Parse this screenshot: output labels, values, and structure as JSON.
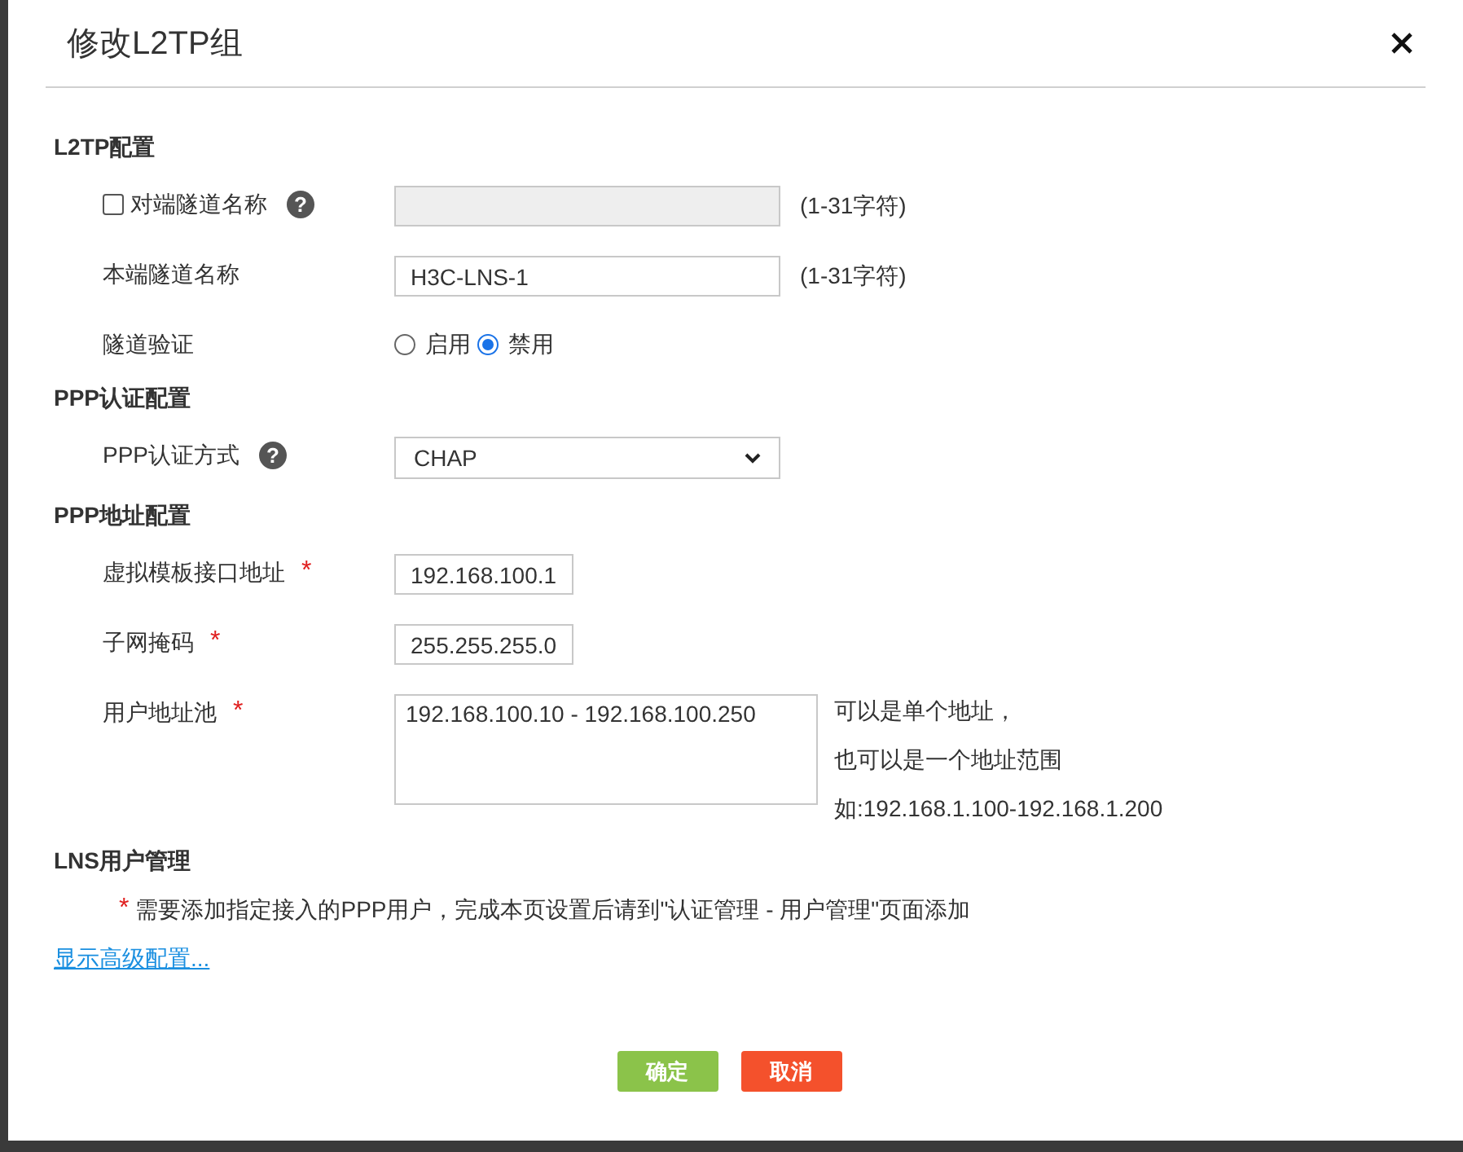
{
  "dialog": {
    "title": "修改L2TP组"
  },
  "sections": [
    {
      "heading": "L2TP配置",
      "rows": [
        {
          "kind": "input",
          "label": "对端隧道名称",
          "checkbox": {
            "checked": false
          },
          "help": "?",
          "disabled": true,
          "hint": "(1-31字符)"
        },
        {
          "kind": "input",
          "label": "本端隧道名称",
          "value": "H3C-LNS-1",
          "disabled": false,
          "hint": "(1-31字符)"
        },
        {
          "kind": "radio",
          "label": "隧道验证",
          "options": [
            {
              "label": "启用",
              "selected": false
            },
            {
              "label": "禁用",
              "selected": true
            }
          ]
        }
      ]
    },
    {
      "heading": "PPP认证配置",
      "rows": [
        {
          "kind": "select",
          "label": "PPP认证方式",
          "help": "?",
          "value": "CHAP"
        }
      ]
    },
    {
      "heading": "PPP地址配置",
      "rows": [
        {
          "kind": "short_input",
          "label": "虚拟模板接口地址",
          "required": "*",
          "value": "192.168.100.1"
        },
        {
          "kind": "short_input",
          "label": "子网掩码",
          "required": "*",
          "value": "255.255.255.0"
        },
        {
          "kind": "textarea",
          "label": "用户地址池",
          "required": "*",
          "value": "192.168.100.10 - 192.168.100.250",
          "hints": [
            "可以是单个地址，",
            "也可以是一个地址范围",
            "如:192.168.1.100-192.168.1.200"
          ]
        }
      ]
    },
    {
      "heading": "LNS用户管理",
      "rows": [
        {
          "kind": "note",
          "required": "*",
          "text": "需要添加指定接入的PPP用户，完成本页设置后请到\"认证管理 - 用户管理\"页面添加"
        }
      ]
    }
  ],
  "advanced_link": "显示高级配置...",
  "buttons": [
    {
      "label": "确定",
      "kind": "primary"
    },
    {
      "label": "取消",
      "kind": "danger"
    }
  ]
}
